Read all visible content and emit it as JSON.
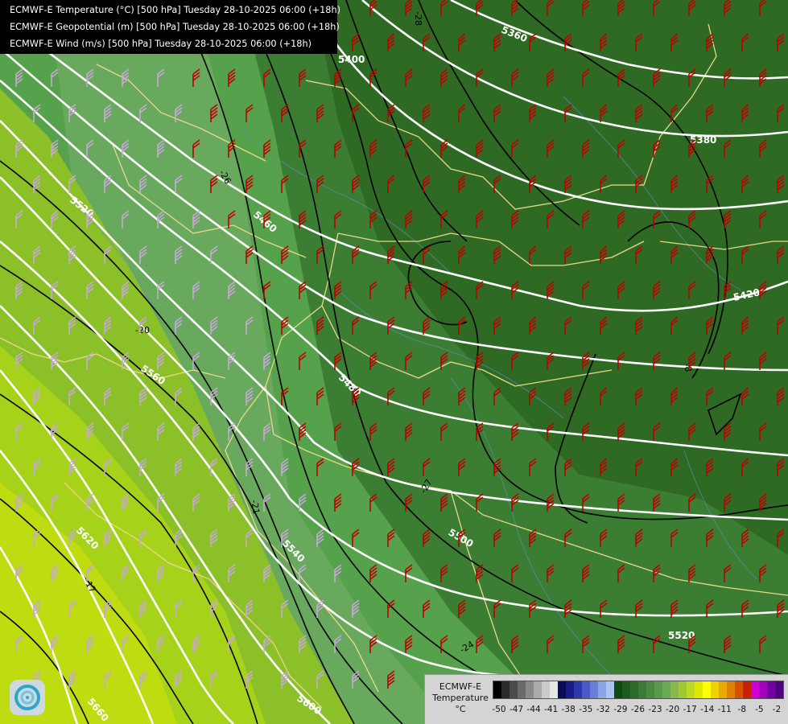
{
  "header": {
    "lines": [
      "ECMWF-E Temperature (°C) [500 hPa] Tuesday 28-10-2025 06:00 (+18h)",
      "ECMWF-E Geopotential (m) [500 hPa] Tuesday 28-10-2025 06:00 (+18h)",
      "ECMWF-E Wind (m/s) [500 hPa] Tuesday 28-10-2025 06:00 (+18h)"
    ]
  },
  "legend": {
    "title_line1": "ECMWF-E",
    "title_line2": "Temperature",
    "unit": "°C",
    "colors": [
      "#000000",
      "#2a2a2a",
      "#4a4a4a",
      "#6a6a6a",
      "#8a8a8a",
      "#aaaaaa",
      "#cacaca",
      "#e6e6e6",
      "#0a0a5a",
      "#1a1a8a",
      "#2a3aaa",
      "#4a5ac6",
      "#6a7ed6",
      "#8aa6e6",
      "#aac6f0",
      "#0f4a0f",
      "#1f5a1f",
      "#2f6a2a",
      "#3a7a35",
      "#4a8a40",
      "#5a9a4a",
      "#6aaa55",
      "#8ab84a",
      "#a0c830",
      "#c0d820",
      "#e0e800",
      "#ffff00",
      "#f0d000",
      "#e8a800",
      "#e08000",
      "#d85000",
      "#c82000",
      "#d000d0",
      "#a000c0",
      "#7000a0",
      "#500080"
    ],
    "ticks": [
      "-50",
      "-47",
      "-44",
      "-41",
      "-38",
      "-35",
      "-32",
      "-29",
      "-26",
      "-23",
      "-20",
      "-17",
      "-14",
      "-11",
      "-8",
      "-5",
      "-2"
    ]
  },
  "contour_labels": {
    "geopotential": [
      "5360",
      "5380",
      "5400",
      "5420",
      "5460",
      "5480",
      "5500",
      "5520",
      "5520",
      "5540",
      "5560",
      "5600",
      "5620",
      "5660"
    ],
    "temperature": [
      "-28",
      "-20",
      "-21",
      "-17",
      "-24",
      "-27",
      "-26",
      "-8"
    ]
  },
  "map_colors": {
    "cold_core": "#2e6a24",
    "cold": "#3b7d33",
    "mid": "#56a24c",
    "band": "#6aaa60",
    "warm": "#8cc028",
    "warmer": "#a7d21a",
    "warmest": "#bedc10",
    "wind_cold": "#c10000",
    "wind_warm": "#c7a7d9",
    "border": "#e8d98a",
    "river": "#5f8fb8",
    "isohypse": "#ffffff",
    "isotherm": "#000000"
  }
}
